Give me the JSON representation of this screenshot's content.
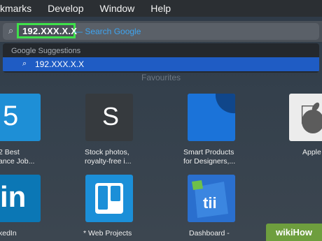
{
  "menubar": {
    "items": [
      "kmarks",
      "Develop",
      "Window",
      "Help"
    ]
  },
  "urlbar": {
    "value": "192.XXX.X.X",
    "hint": "— Search Google"
  },
  "dropdown": {
    "header": "Google Suggestions",
    "item": "192.XXX.X.X"
  },
  "favourites": {
    "label": "Favourites",
    "tiles": [
      {
        "glyph": "5",
        "caption": [
          "2 Best",
          "ance Job..."
        ]
      },
      {
        "glyph": "S",
        "caption": [
          "Stock photos,",
          "royalty-free i..."
        ]
      },
      {
        "glyph": "",
        "caption": [
          "Smart Products",
          "for Designers,..."
        ]
      },
      {
        "glyph": "",
        "caption": [
          "Apple"
        ]
      },
      {
        "glyph": "in",
        "caption": [
          "kedIn"
        ]
      },
      {
        "glyph": "",
        "caption": [
          "* Web Projects",
          ""
        ]
      },
      {
        "glyph": "",
        "caption": [
          "Dashboard -",
          ""
        ]
      }
    ]
  },
  "watermark": "wikiHow",
  "colors": {
    "highlight": "#3ee04a",
    "selection": "#1f5cc4",
    "hint": "#3fa4f0"
  }
}
